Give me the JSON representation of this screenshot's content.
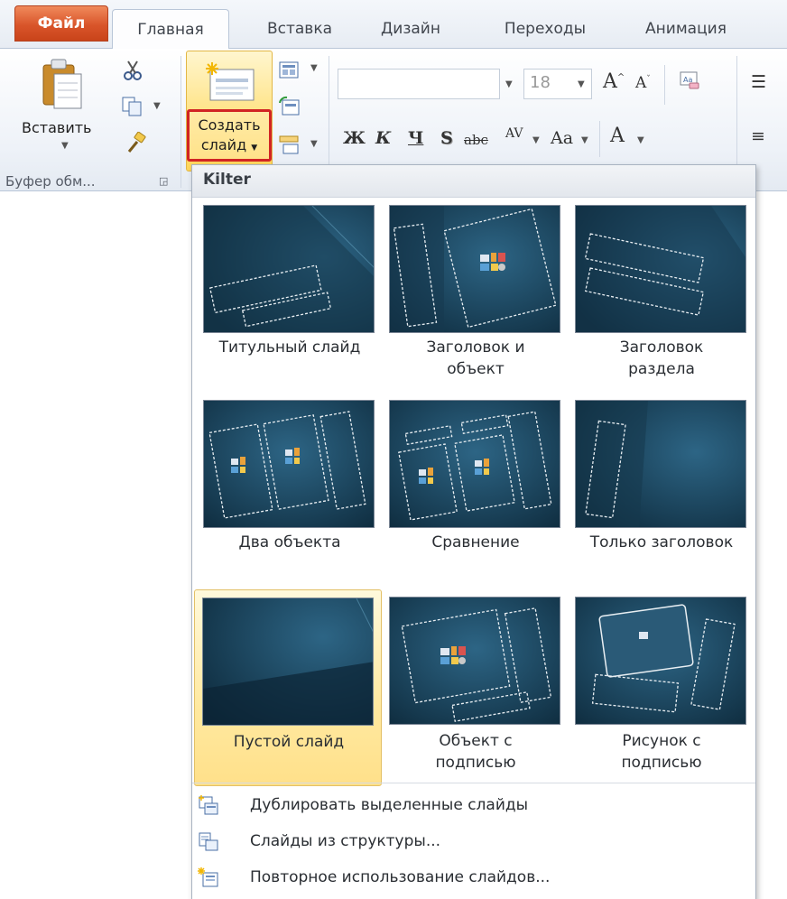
{
  "tabs": {
    "file": "Файл",
    "home": "Главная",
    "insert": "Вставка",
    "design": "Дизайн",
    "transitions": "Переходы",
    "animation": "Анимация"
  },
  "clipboard": {
    "paste_label": "Вставить",
    "group_label": "Буфер обм..."
  },
  "slides": {
    "new_slide_line1": "Создать",
    "new_slide_line2": "слайд"
  },
  "font": {
    "size_value": "18",
    "bold": "Ж",
    "italic": "К",
    "underline": "Ч",
    "shadow": "S",
    "strike": "abc",
    "spacing": "AV",
    "case": "Aa",
    "color": "A"
  },
  "gallery": {
    "theme_name": "Kilter",
    "layouts": [
      {
        "line1": "Титульный слайд",
        "line2": ""
      },
      {
        "line1": "Заголовок и",
        "line2": "объект"
      },
      {
        "line1": "Заголовок",
        "line2": "раздела"
      },
      {
        "line1": "Два объекта",
        "line2": ""
      },
      {
        "line1": "Сравнение",
        "line2": ""
      },
      {
        "line1": "Только заголовок",
        "line2": ""
      },
      {
        "line1": "Пустой слайд",
        "line2": ""
      },
      {
        "line1": "Объект с",
        "line2": "подписью"
      },
      {
        "line1": "Рисунок с",
        "line2": "подписью"
      }
    ],
    "selected_index": 6
  },
  "commands": {
    "duplicate": "Дублировать выделенные слайды",
    "from_outline": "Слайды из структуры...",
    "reuse": "Повторное использование слайдов..."
  },
  "colors": {
    "file_tab": "#d9552a",
    "highlight": "#ffe489",
    "outline_red": "#d12424",
    "thumb_bg": "#1b4a66"
  },
  "icons": {
    "paste": "clipboard-icon",
    "cut": "scissors-icon",
    "copy": "copy-icon",
    "format_painter": "brush-icon",
    "layout": "layout-icon",
    "reset": "reset-icon",
    "section": "section-icon"
  }
}
